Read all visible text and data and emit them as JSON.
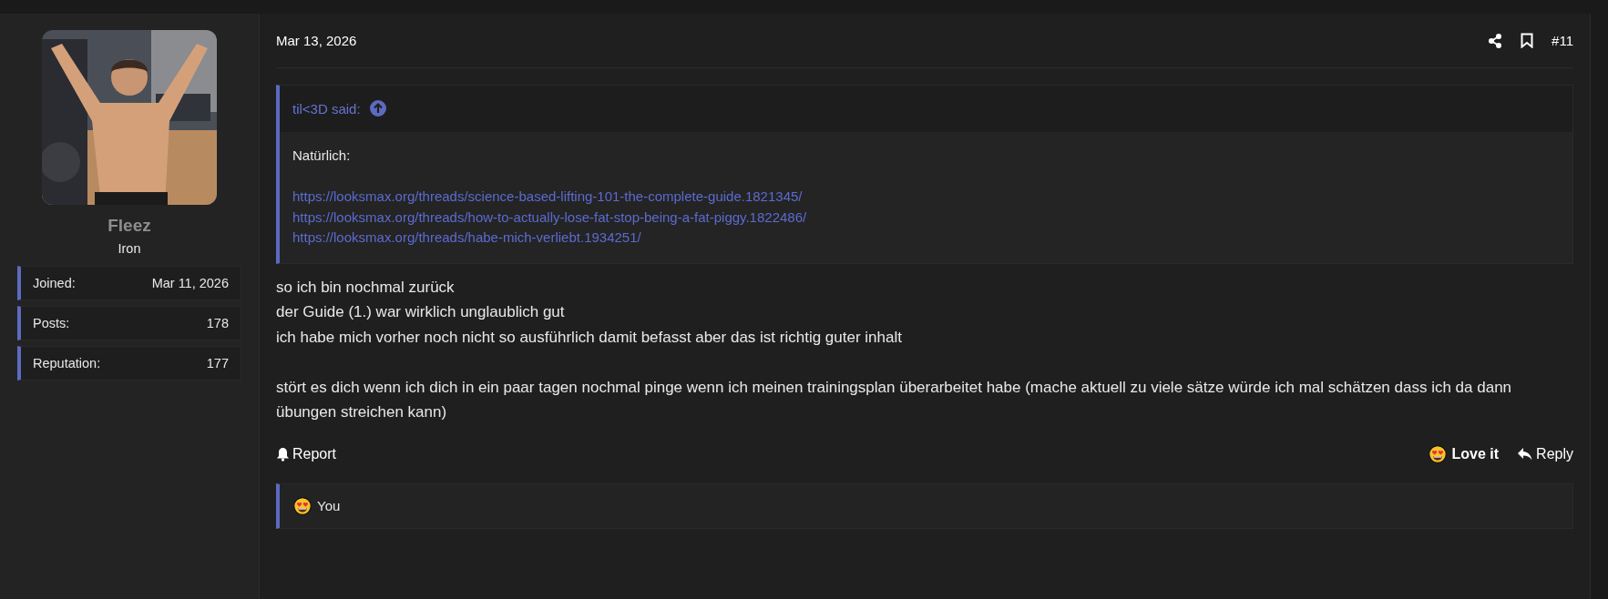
{
  "user": {
    "name": "Fleez",
    "rank": "Iron",
    "stats": [
      {
        "label": "Joined:",
        "value": "Mar 11, 2026"
      },
      {
        "label": "Posts:",
        "value": "178"
      },
      {
        "label": "Reputation:",
        "value": "177"
      }
    ]
  },
  "post": {
    "date": "Mar 13, 2026",
    "number": "#11",
    "quote": {
      "author": "til<3D said:",
      "intro": "Natürlich:",
      "links": [
        "https://looksmax.org/threads/science-based-lifting-101-the-complete-guide.1821345/",
        "https://looksmax.org/threads/how-to-actually-lose-fat-stop-being-a-fat-piggy.1822486/",
        "https://looksmax.org/threads/habe-mich-verliebt.1934251/"
      ]
    },
    "paragraphs": [
      [
        "so ich bin nochmal zurück",
        "der Guide (1.) war wirklich unglaublich gut",
        "ich habe mich vorher noch nicht so ausführlich damit befasst aber das ist richtig guter inhalt"
      ],
      [
        "stört es dich wenn ich dich in ein paar tagen nochmal pinge wenn ich meinen trainingsplan überarbeitet habe (mache aktuell zu viele sätze würde ich mal schätzen dass ich da dann übungen streichen kann)"
      ]
    ],
    "actions": [
      {
        "kind": "report",
        "label": "Report",
        "active": false
      },
      {
        "kind": "love",
        "label": "Love it",
        "active": true
      },
      {
        "kind": "reply",
        "label": "Reply",
        "active": false
      }
    ],
    "reactions": {
      "kind": "love",
      "text": "You"
    }
  }
}
